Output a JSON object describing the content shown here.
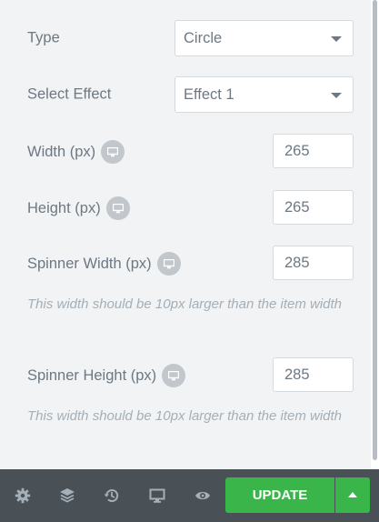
{
  "controls": {
    "type": {
      "label": "Type",
      "value": "Circle"
    },
    "effect": {
      "label": "Select Effect",
      "value": "Effect 1"
    },
    "width": {
      "label": "Width (px)",
      "value": "265"
    },
    "height": {
      "label": "Height (px)",
      "value": "265"
    },
    "spinner_width": {
      "label": "Spinner Width (px)",
      "value": "285",
      "note": "This width should be 10px larger than the item width"
    },
    "spinner_height": {
      "label": "Spinner Height (px)",
      "value": "285",
      "note": "This width should be 10px larger than the item width"
    }
  },
  "footer": {
    "icons": [
      "gear-icon",
      "layers-icon",
      "history-icon",
      "desktop-icon",
      "eye-icon"
    ],
    "update_label": "UPDATE",
    "accent_color": "#39b54a",
    "bar_color": "#495157"
  }
}
